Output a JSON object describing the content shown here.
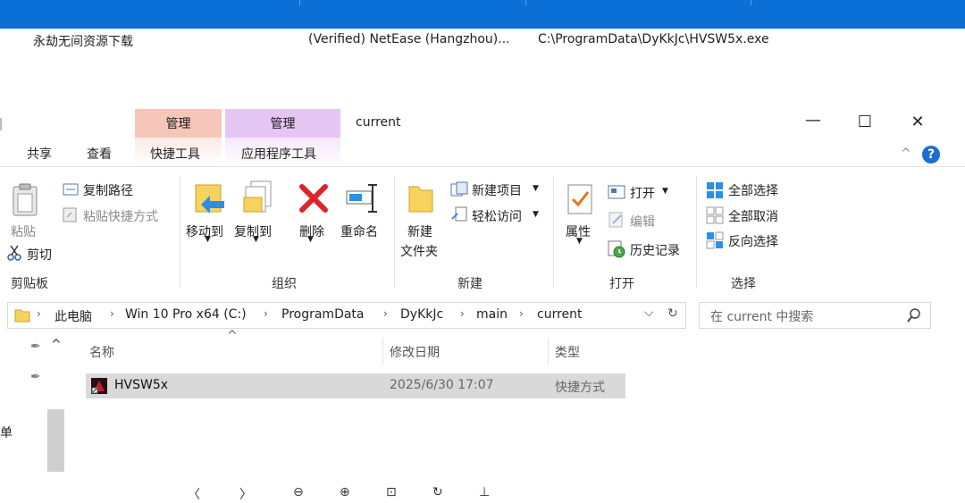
{
  "process_row": {
    "name": "永劫无间资源下载",
    "publisher": "(Verified) NetEase (Hangzhou)...",
    "path": "C:\\ProgramData\\DyKkJc\\HVSW5x.exe"
  },
  "window": {
    "title": "current",
    "minimize": "—",
    "maximize": "☐",
    "close": "✕",
    "expand": "^",
    "help": "?"
  },
  "ribbon_tabs": {
    "ctx1_header": "管理",
    "ctx2_header": "管理",
    "share": "共享",
    "view": "查看",
    "shortcut_tools": "快捷工具",
    "app_tools": "应用程序工具"
  },
  "colors": {
    "ctx1": "#f6c7b9",
    "ctx2": "#e5c5f2",
    "accent": "#0a6fd6"
  },
  "clipboard": {
    "paste": "粘贴",
    "copy_path": "复制路径",
    "paste_shortcut": "粘贴快捷方式",
    "cut": "剪切",
    "group": "剪贴板"
  },
  "organize": {
    "move_to": "移动到",
    "copy_to": "复制到",
    "delete": "删除",
    "rename": "重命名",
    "group": "组织"
  },
  "new": {
    "new_folder_1": "新建",
    "new_folder_2": "文件夹",
    "new_item": "新建项目",
    "easy_access": "轻松访问",
    "group": "新建"
  },
  "open": {
    "properties": "属性",
    "open": "打开",
    "edit": "编辑",
    "history": "历史记录",
    "group": "打开"
  },
  "select": {
    "select_all": "全部选择",
    "select_none": "全部取消",
    "invert": "反向选择",
    "group": "选择"
  },
  "address": {
    "crumbs": [
      "此电脑",
      "Win 10 Pro x64 (C:)",
      "ProgramData",
      "DyKkJc",
      "main",
      "current"
    ],
    "search_placeholder": "在 current 中搜索"
  },
  "columns": {
    "name": "名称",
    "modified": "修改日期",
    "type": "类型"
  },
  "files": [
    {
      "name": "HVSW5x",
      "modified": "2025/6/30 17:07",
      "type": "快捷方式"
    }
  ],
  "nav": {
    "partial_label": "单"
  }
}
